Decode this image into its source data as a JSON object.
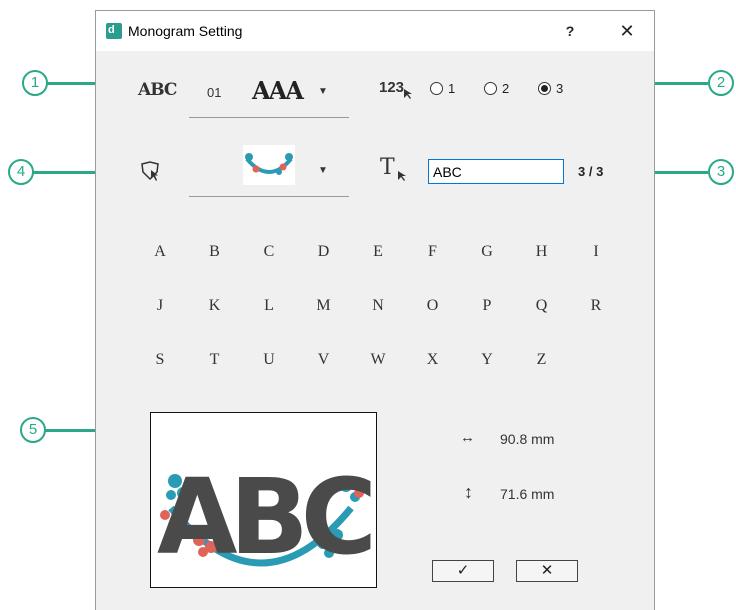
{
  "window": {
    "title": "Monogram Setting",
    "help_label": "?",
    "close_label": "✕"
  },
  "callouts": [
    "1",
    "2",
    "3",
    "4",
    "5"
  ],
  "font_row": {
    "font_number": "01",
    "font_preview": "AAA"
  },
  "lines_row": {
    "icon_text": "123",
    "options": [
      {
        "label": "1",
        "selected": false
      },
      {
        "label": "2",
        "selected": false
      },
      {
        "label": "3",
        "selected": true
      }
    ]
  },
  "text_row": {
    "value": "ABC",
    "count": "3 / 3"
  },
  "letters": [
    "A",
    "B",
    "C",
    "D",
    "E",
    "F",
    "G",
    "H",
    "I",
    "J",
    "K",
    "L",
    "M",
    "N",
    "O",
    "P",
    "Q",
    "R",
    "S",
    "T",
    "U",
    "V",
    "W",
    "X",
    "Y",
    "Z"
  ],
  "preview": {
    "text": "ABC",
    "width": "90.8 mm",
    "height": "71.6 mm"
  },
  "buttons": {
    "ok_label": "✓",
    "cancel_label": "✕"
  },
  "colors": {
    "accent": "#2aa889",
    "monogram": "#4a4a4a",
    "frame_teal": "#2a9bb5",
    "frame_red": "#e0635a"
  }
}
